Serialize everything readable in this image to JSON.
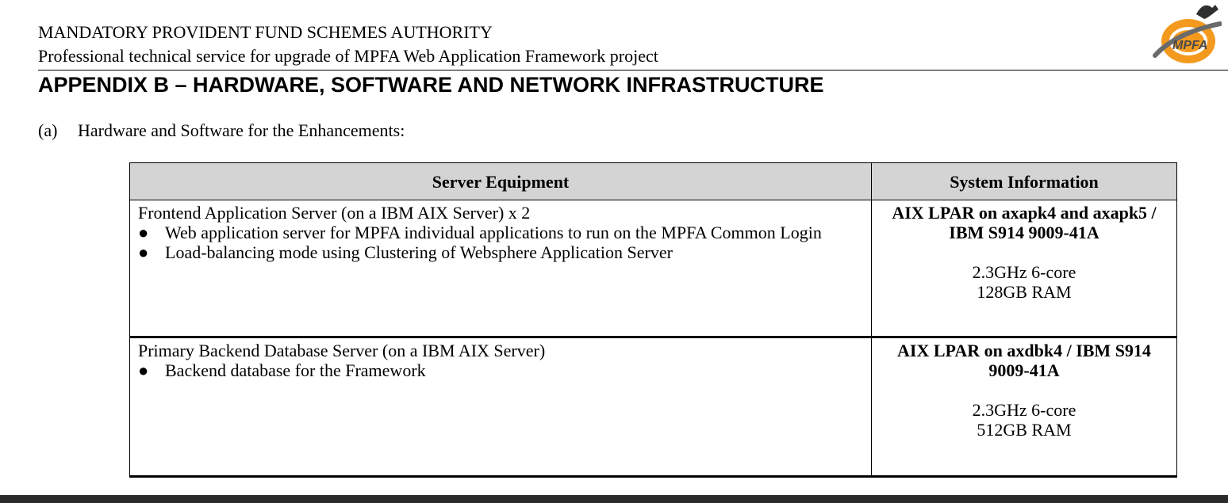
{
  "header": {
    "org": "MANDATORY PROVIDENT FUND SCHEMES AUTHORITY",
    "project": "Professional technical service for upgrade of MPFA Web Application Framework project",
    "logo_text": "MPFA"
  },
  "appendix_title": "APPENDIX B – HARDWARE, SOFTWARE AND NETWORK INFRASTRUCTURE",
  "section": {
    "marker": "(a)",
    "title": "Hardware and Software for the Enhancements:"
  },
  "table": {
    "headers": [
      "Server Equipment",
      "System Information"
    ],
    "rows": [
      {
        "server": "Frontend Application Server (on a IBM AIX Server) x 2",
        "bullets": [
          "Web application server for MPFA individual applications to run on the MPFA Common Login",
          "Load-balancing mode using Clustering of Websphere Application Server"
        ],
        "system_bold": "AIX LPAR on axapk4 and axapk5 / IBM S914 9009-41A",
        "cpu": "2.3GHz 6-core",
        "ram": "128GB RAM"
      },
      {
        "server": "Primary Backend Database Server (on a IBM AIX Server)",
        "bullets": [
          "Backend database for the Framework"
        ],
        "system_bold": "AIX LPAR on axdbk4 / IBM S914 9009-41A",
        "cpu": "2.3GHz 6-core",
        "ram": "512GB RAM"
      }
    ]
  },
  "bullet_glyph": "●"
}
